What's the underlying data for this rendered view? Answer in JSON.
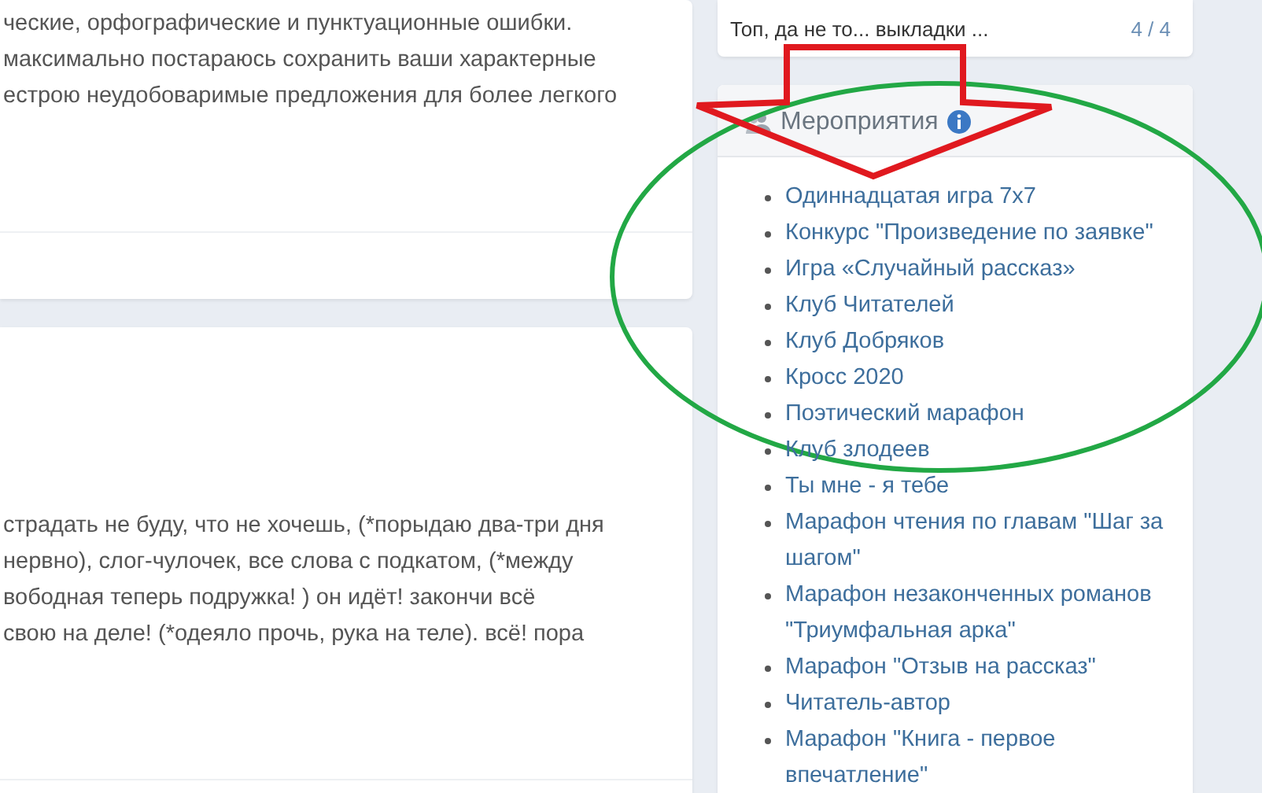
{
  "left_cards": [
    {
      "lines": [
        "ческие, орфографические и пунктуационные ошибки.",
        "максимально постараюсь сохранить ваши характерные",
        "естрою неудобоваримые предложения для более легкого"
      ]
    },
    {
      "lines": [
        "страдать не буду, что не хочешь, (*порыдаю два-три дня",
        "нервно), слог-чулочек, все слова с подкатом, (*между",
        "вободная теперь подружка! ) он идёт! закончи всё",
        "свою на деле! (*одеяло прочь, рука на теле). всё! пора"
      ]
    }
  ],
  "top_card": {
    "title": "Топ, да не то... выкладки ...",
    "count": "4 / 4"
  },
  "events": {
    "title": "Мероприятия",
    "items": [
      "Одиннадцатая игра 7x7",
      "Конкурс \"Произведение по заявке\"",
      "Игра «Случайный рассказ»",
      "Клуб Читателей",
      "Клуб Добряков",
      "Кросс 2020",
      "Поэтический марафон",
      "Клуб злодеев",
      "Ты мне - я тебе",
      "Марафон чтения по главам \"Шаг за шагом\"",
      "Марафон незаконченных романов \"Триумфальная арка\"",
      "Марафон \"Отзыв на рассказ\"",
      "Читатель-автор",
      "Марафон \"Книга - первое впечатление\""
    ]
  }
}
